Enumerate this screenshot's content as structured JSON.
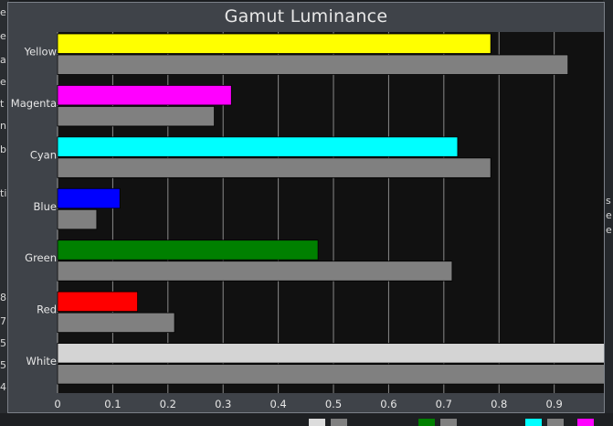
{
  "chart_data": {
    "type": "bar",
    "orientation": "horizontal",
    "title": "Gamut Luminance",
    "xlabel": "",
    "ylabel": "",
    "xlim": [
      0,
      0.99
    ],
    "xticks": [
      "0",
      "0.1",
      "0.2",
      "0.3",
      "0.4",
      "0.5",
      "0.6",
      "0.7",
      "0.8",
      "0.9"
    ],
    "grid": true,
    "categories": [
      "Yellow",
      "Magenta",
      "Cyan",
      "Blue",
      "Green",
      "Red",
      "White"
    ],
    "measured": [
      0.785,
      0.315,
      0.725,
      0.113,
      0.472,
      0.145,
      0.997
    ],
    "reference": [
      0.925,
      0.284,
      0.785,
      0.071,
      0.715,
      0.212,
      0.997
    ],
    "colors": {
      "Yellow": "#ffff00",
      "Magenta": "#ff00ff",
      "Cyan": "#00ffff",
      "Blue": "#0000ff",
      "Green": "#008000",
      "Red": "#ff0000",
      "White": "#d4d4d4",
      "reference": "#808080",
      "plot_background": "#111111",
      "grid": "#8a8a8a"
    }
  },
  "background_fragments": {
    "left": [
      "e",
      "e",
      "a",
      "e",
      "t",
      "n",
      "b",
      "ti",
      "8",
      "7",
      "5",
      "5",
      "4"
    ],
    "right": [
      "s",
      "e",
      "e"
    ]
  }
}
